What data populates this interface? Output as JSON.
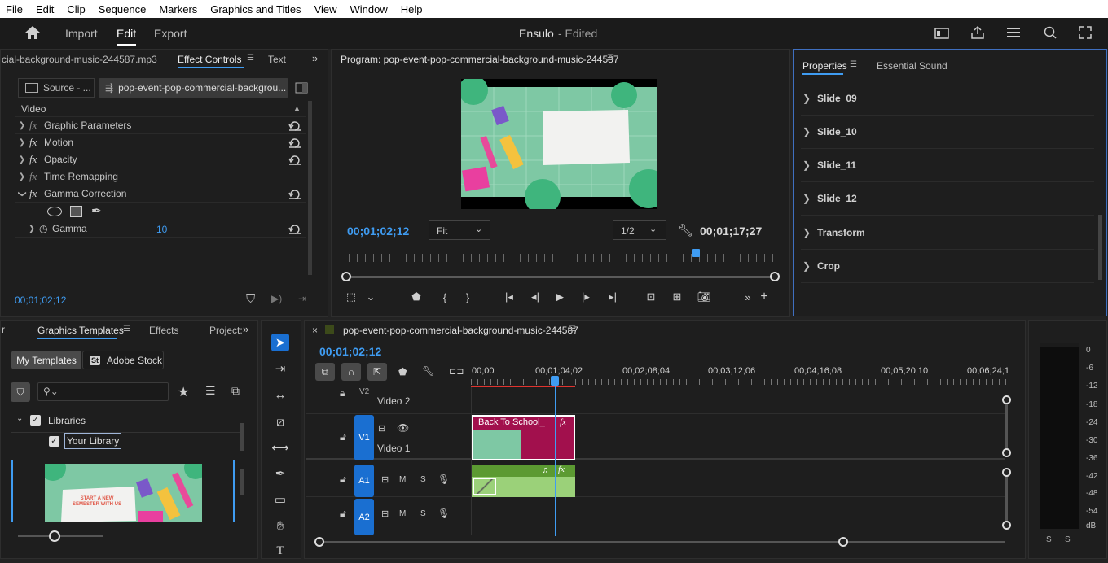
{
  "menu": [
    "File",
    "Edit",
    "Clip",
    "Sequence",
    "Markers",
    "Graphics and Titles",
    "View",
    "Window",
    "Help"
  ],
  "header": {
    "nav": [
      "Import",
      "Edit",
      "Export"
    ],
    "active": "Edit",
    "project_title": "Ensulo",
    "status": "- Edited"
  },
  "effect_controls": {
    "tabs": [
      "cial-background-music-244587.mp3",
      "Effect Controls",
      "Text"
    ],
    "source_tab": "Source - ...",
    "clip_tab": "pop-event-pop-commercial-backgrou...",
    "section": "Video",
    "effects": [
      "Graphic Parameters",
      "Motion",
      "Opacity",
      "Time Remapping",
      "Gamma Correction"
    ],
    "param_label": "Gamma",
    "param_value": "10",
    "timecode": "00;01;02;12"
  },
  "program": {
    "title": "Program: pop-event-pop-commercial-background-music-244587",
    "timecode": "00;01;02;12",
    "fit": "Fit",
    "resolution": "1/2",
    "duration": "00;01;17;27",
    "playhead_progress": 0.81
  },
  "properties": {
    "tabs": [
      "Properties",
      "Essential Sound"
    ],
    "items": [
      "Slide_09",
      "Slide_10",
      "Slide_11",
      "Slide_12",
      "Transform",
      "Crop"
    ]
  },
  "graphics": {
    "tabs": [
      "Graphics Templates",
      "Effects",
      "Project:"
    ],
    "subtabs": [
      "My Templates",
      "Adobe Stock"
    ],
    "stock_badge": "St",
    "libraries": "Libraries",
    "your_library": "Your Library",
    "thumb_text": "START A NEW SEMESTER WITH US"
  },
  "timeline": {
    "title": "pop-event-pop-commercial-background-music-244587",
    "timecode": "00;01;02;12",
    "ruler": [
      "00;00",
      "00;01;04;02",
      "00;02;08;04",
      "00;03;12;06",
      "00;04;16;08",
      "00;05;20;10",
      "00;06;24;1"
    ],
    "tracks": {
      "v2": "V2",
      "v2_name": "Video 2",
      "v1": "V1",
      "v1_name": "Video 1",
      "a1": "A1",
      "a2": "A2",
      "m": "M",
      "s": "S"
    },
    "clip_label": "Back To School_",
    "fx": "fx"
  },
  "meter": {
    "labels": [
      "0",
      "-6",
      "-12",
      "-18",
      "-24",
      "-30",
      "-36",
      "-42",
      "-48",
      "-54",
      "dB"
    ],
    "solo": [
      "S",
      "S"
    ]
  },
  "colors": {
    "accent": "#3f9cf2",
    "clip_video": "#a2104d",
    "clip_audio": "#5c9a32",
    "playhead": "#3f9cf2"
  }
}
